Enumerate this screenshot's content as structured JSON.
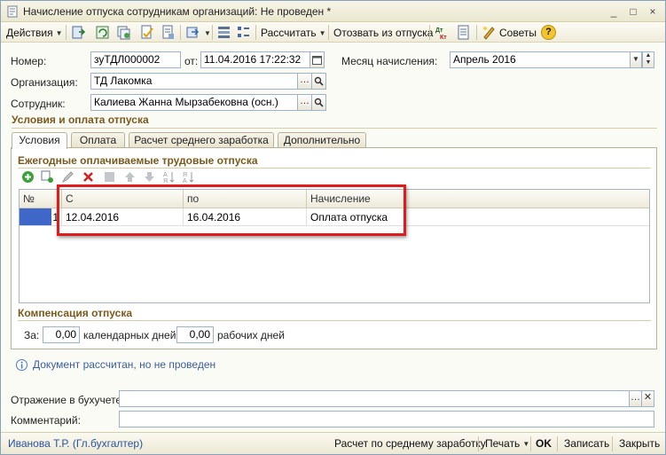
{
  "window": {
    "title": "Начисление отпуска сотрудникам организаций: Не проведен *",
    "controls": [
      "_",
      "□",
      "×"
    ]
  },
  "toolbar": {
    "actions_label": "Действия",
    "calculate_label": "Рассчитать",
    "recall_label": "Отозвать из отпуска",
    "tips_label": "Советы",
    "help_label": "?"
  },
  "header": {
    "number_label": "Номер:",
    "number_value": "зуТДЛ000002",
    "date_label": "от:",
    "date_value": "11.04.2016 17:22:32",
    "month_label": "Месяц начисления:",
    "month_value": "Апрель 2016",
    "org_label": "Организация:",
    "org_value": "ТД Лакомка",
    "employee_label": "Сотрудник:",
    "employee_value": "Калиева Жанна Мырзабековна  (осн.)"
  },
  "section": {
    "title": "Условия и оплата отпуска"
  },
  "tabs": [
    {
      "label": "Условия"
    },
    {
      "label": "Оплата"
    },
    {
      "label": "Расчет среднего заработка"
    },
    {
      "label": "Дополнительно"
    }
  ],
  "vacations": {
    "title": "Ежегодные оплачиваемые трудовые отпуска",
    "columns": [
      "№",
      "С",
      "по",
      "Начисление"
    ],
    "rows": [
      {
        "num": "1",
        "from": "12.04.2016",
        "to": "16.04.2016",
        "accrual": "Оплата отпуска"
      }
    ]
  },
  "compensation": {
    "title": "Компенсация отпуска",
    "for_label": "За:",
    "calendar_value": "0,00",
    "calendar_label": "календарных дней",
    "working_value": "0,00",
    "working_label": "рабочих дней"
  },
  "info": {
    "text": "Документ рассчитан, но не проведен"
  },
  "footer": {
    "accounting_label": "Отражение в бухучете:",
    "accounting_value": "",
    "comment_label": "Комментарий:",
    "comment_value": ""
  },
  "status": {
    "user": "Иванова Т.Р. (Гл.бухгалтер)",
    "avg_calc": "Расчет по среднему заработку",
    "print": "Печать",
    "ok": "OK",
    "save": "Записать",
    "close": "Закрыть"
  },
  "colors": {
    "highlight": "#e01b1b",
    "section_title": "#7a5a1c",
    "link": "#3a5e9e",
    "selected_row_marker": "#3f67c8"
  }
}
